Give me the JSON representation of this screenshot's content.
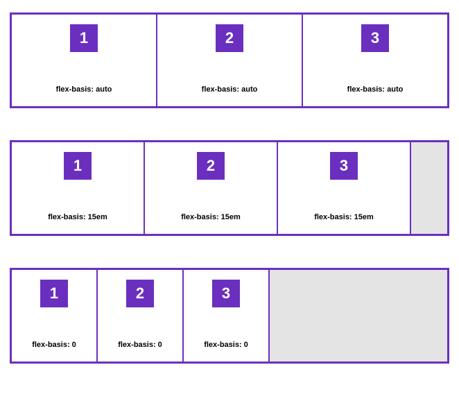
{
  "colors": {
    "accent": "#6b2fbf",
    "empty_bg": "#e4e4e4"
  },
  "rows": [
    {
      "id": "auto",
      "items": [
        {
          "number": "1",
          "caption": "flex-basis: auto"
        },
        {
          "number": "2",
          "caption": "flex-basis: auto"
        },
        {
          "number": "3",
          "caption": "flex-basis: auto"
        }
      ]
    },
    {
      "id": "15em",
      "items": [
        {
          "number": "1",
          "caption": "flex-basis: 15em"
        },
        {
          "number": "2",
          "caption": "flex-basis: 15em"
        },
        {
          "number": "3",
          "caption": "flex-basis: 15em"
        }
      ]
    },
    {
      "id": "zero",
      "items": [
        {
          "number": "1",
          "caption": "flex-basis: 0"
        },
        {
          "number": "2",
          "caption": "flex-basis: 0"
        },
        {
          "number": "3",
          "caption": "flex-basis: 0"
        }
      ]
    }
  ]
}
